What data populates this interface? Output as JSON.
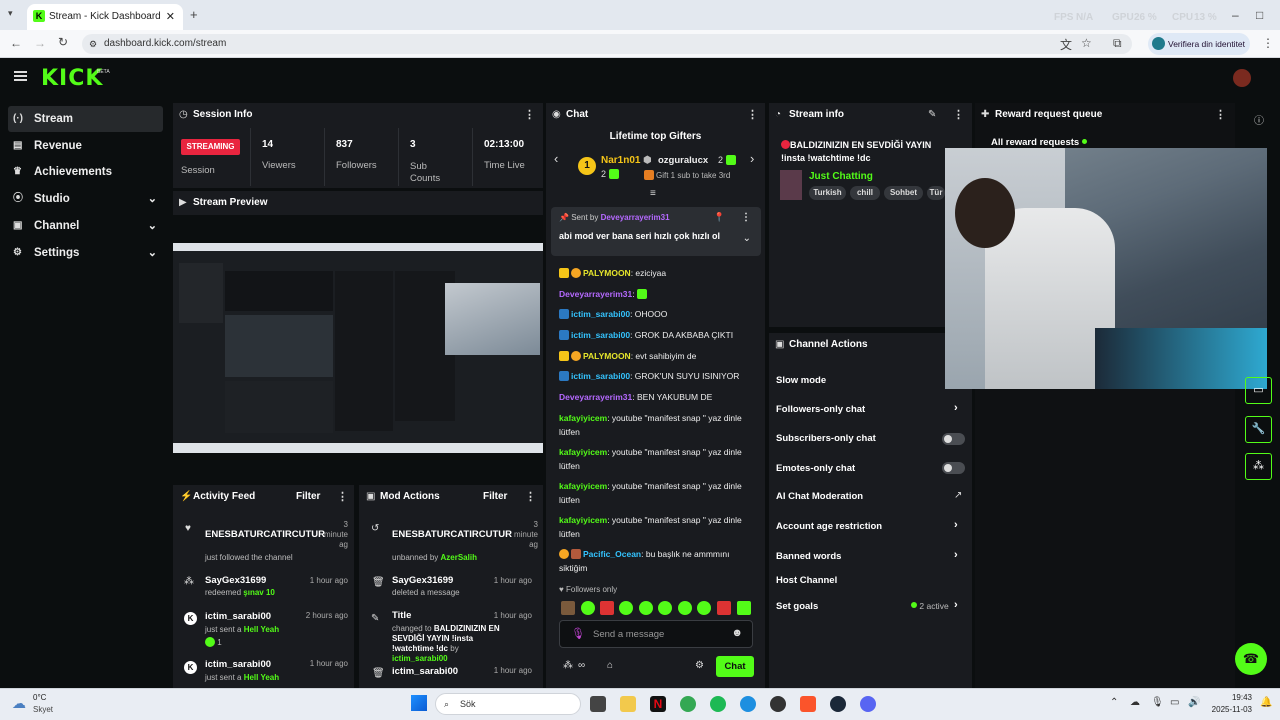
{
  "browser": {
    "tab_title": "Stream - Kick Dashboard",
    "url": "dashboard.kick.com/stream",
    "identity_button": "Verifiera din identitet",
    "perf": [
      "FPS",
      "N/A",
      "GPU",
      "26 %",
      "CPU",
      "13 %"
    ]
  },
  "header": {
    "logo": "KICK",
    "beta": "BETA"
  },
  "sidebar": {
    "items": [
      {
        "label": "Stream",
        "icon": "broadcast-icon"
      },
      {
        "label": "Revenue",
        "icon": "wallet-icon"
      },
      {
        "label": "Achievements",
        "icon": "trophy-icon"
      },
      {
        "label": "Studio",
        "icon": "studio-icon"
      },
      {
        "label": "Channel",
        "icon": "channel-icon"
      },
      {
        "label": "Settings",
        "icon": "gear-icon"
      }
    ]
  },
  "session": {
    "title": "Session Info",
    "status": "STREAMING",
    "session_label": "Session",
    "viewers": "14",
    "viewers_label": "Viewers",
    "followers": "837",
    "followers_label": "Followers",
    "subs": "3",
    "subs_label": "Sub Counts",
    "time": "02:13:00",
    "time_label": "Time Live"
  },
  "preview": {
    "title": "Stream Preview"
  },
  "activity": {
    "title": "Activity Feed",
    "filter": "Filter",
    "items": [
      {
        "name": "ENESBATURCATIRCUTUR",
        "sub_prefix": "just followed the channel",
        "sub_highlight": "",
        "time": "3 minute ag"
      },
      {
        "name": "SayGex31699",
        "sub_prefix": "redeemed",
        "sub_highlight": "şınav 10",
        "time": "1 hour ago"
      },
      {
        "name": "ictim_sarabi00",
        "sub_prefix": "just sent a",
        "sub_highlight": "Hell Yeah",
        "time": "2 hours ago",
        "extra": "1"
      },
      {
        "name": "ictim_sarabi00",
        "sub_prefix": "just sent a",
        "sub_highlight": "Hell Yeah",
        "time": "1 hour ago"
      }
    ]
  },
  "mod": {
    "title": "Mod Actions",
    "filter": "Filter",
    "items": [
      {
        "name": "ENESBATURCATIRCUTUR",
        "time": "3 minute ag",
        "sub_prefix": "unbanned by",
        "sub_highlight": "AzerSalih"
      },
      {
        "name": "SayGex31699",
        "time": "1 hour ago",
        "sub_prefix": "deleted a message",
        "sub_highlight": ""
      },
      {
        "name": "Title",
        "time": "1 hour ago",
        "sub_prefix": "changed to",
        "sub_title": "BALDIZINIZIN EN SEVDİĞİ YAYIN !insta !watchtime !dc",
        "sub_by": "by",
        "sub_highlight": "ictim_sarabi00"
      },
      {
        "name": "ictim_sarabi00",
        "time": "1 hour ago",
        "sub_prefix": "",
        "sub_highlight": ""
      }
    ]
  },
  "chat": {
    "title": "Chat",
    "gifters_title": "Lifetime top Gifters",
    "gifter1": {
      "rank": "1",
      "name": "Nar1n01",
      "count": "2"
    },
    "gifter2": {
      "name": "ozguralucx",
      "count": "2"
    },
    "gift_hint": "Gift 1 sub to take 3rd",
    "pinned_sender_prefix": "Sent by",
    "pinned_sender": "Deveyarrayerim31",
    "pinned_text": "abi mod ver bana seri hızlı çok hızlı ol",
    "messages": [
      {
        "user": "PALYMOON",
        "text": ": eziciyaa",
        "style": "y",
        "badge": "1"
      },
      {
        "user": "Deveyarrayerim31",
        "text": ":",
        "style": "p"
      },
      {
        "user": "ictim_sarabi00",
        "text": ": OHOOO",
        "style": "c"
      },
      {
        "user": "ictim_sarabi00",
        "text": ": GROK DA AKBABA ÇIKTI",
        "style": "c"
      },
      {
        "user": "PALYMOON",
        "text": ": evt sahibiyim de",
        "style": "y",
        "badge": "1"
      },
      {
        "user": "ictim_sarabi00",
        "text": ": GROK'UN SUYU ISINIYOR",
        "style": "c"
      },
      {
        "user": "Deveyarrayerim31",
        "text": ": BEN YAKUBUM DE",
        "style": "p"
      },
      {
        "user": "kafayiyicem",
        "text": ": youtube \"manifest snap \" yaz dinle lütfen",
        "style": "g"
      },
      {
        "user": "kafayiyicem",
        "text": ": youtube \"manifest snap \" yaz dinle lütfen",
        "style": "g"
      },
      {
        "user": "kafayiyicem",
        "text": ": youtube \"manifest snap \" yaz dinle lütfen",
        "style": "g"
      },
      {
        "user": "kafayiyicem",
        "text": ": youtube \"manifest snap \" yaz dinle lütfen",
        "style": "g"
      },
      {
        "user": "Pacific_Ocean",
        "text": ": bu başlık ne ammmını siktiğim",
        "style": "c",
        "badge": "1"
      }
    ],
    "followers_only": "Followers only",
    "placeholder": "Send a message",
    "send": "Chat"
  },
  "stream_info": {
    "title": "Stream info",
    "stream_title": "BALDIZINIZIN EN SEVDİĞİ YAYIN !insta !watchtime !dc",
    "category": "Just Chatting",
    "tags": [
      "Turkish",
      "chill",
      "Sohbet",
      "Tür"
    ]
  },
  "channel_actions": {
    "title": "Channel Actions",
    "items": [
      {
        "label": "Slow mode",
        "control": "none"
      },
      {
        "label": "Followers-only chat",
        "control": "arrow"
      },
      {
        "label": "Subscribers-only chat",
        "control": "toggle"
      },
      {
        "label": "Emotes-only chat",
        "control": "toggle"
      },
      {
        "label": "AI Chat Moderation",
        "control": "ext"
      },
      {
        "label": "Account age restriction",
        "control": "arrow"
      },
      {
        "label": "Banned words",
        "control": "arrow"
      },
      {
        "label": "Host Channel",
        "control": "none"
      },
      {
        "label": "Set goals",
        "control": "arrow",
        "extra": "2 active"
      }
    ]
  },
  "reward": {
    "title": "Reward request queue",
    "all": "All reward requests"
  },
  "taskbar": {
    "temp": "0°C",
    "weather": "Skyet",
    "search": "Sök",
    "time": "19:43",
    "date": "2025-11-03"
  }
}
